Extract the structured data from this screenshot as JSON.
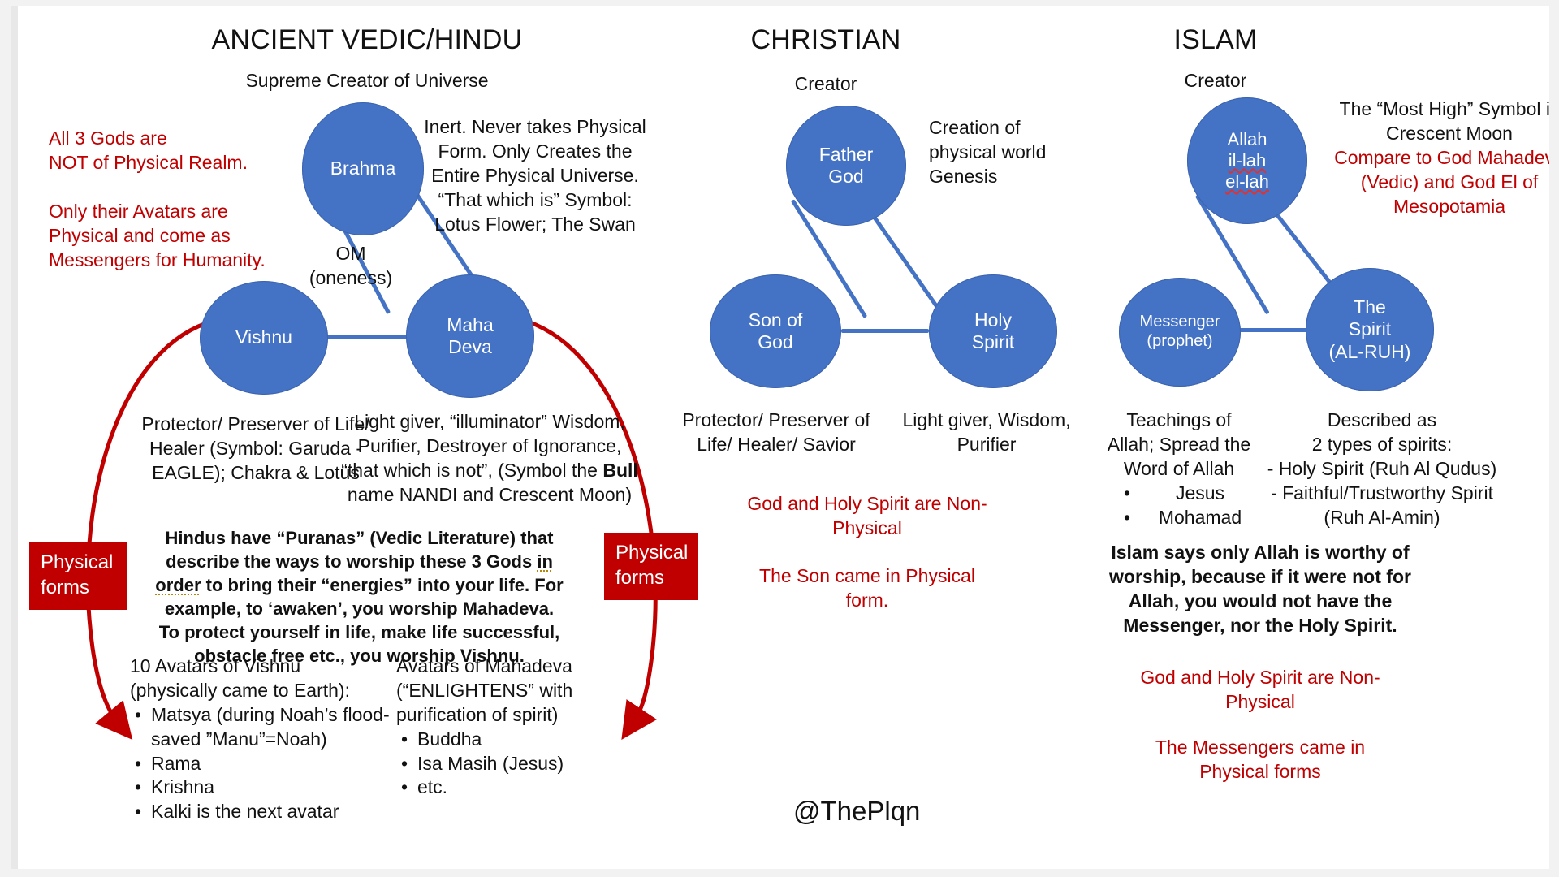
{
  "theme": {
    "node_fill": "#4472C4",
    "accent_red": "#C00000",
    "arrow_red": "#C00000",
    "text_color": "#111111",
    "slide_bg": "#FFFFFF"
  },
  "columns": [
    {
      "key": "vedic",
      "title": "ANCIENT VEDIC/HINDU",
      "top_caption": "Supreme Creator of Universe",
      "nodes": [
        {
          "id": "brahma",
          "label": "Brahma"
        },
        {
          "id": "vishnu",
          "label": "Vishnu"
        },
        {
          "id": "mahadeva",
          "line1": "Maha",
          "line2": "Deva"
        }
      ],
      "center_label_line1": "OM",
      "center_label_line2": "(oneness)",
      "left_note_1_line1": "All 3 Gods are",
      "left_note_1_line2": "NOT of Physical Realm.",
      "left_note_2": "Only their Avatars are Physical and come as Messengers for Humanity.",
      "brahma_desc": "Inert. Never takes Physical Form.  Only Creates the Entire Physical Universe. “That which is” Symbol: Lotus Flower; The Swan",
      "vishnu_desc": "Protector/ Preserver of Life/ Healer (Symbol: Garuda - EAGLE); Chakra & Lotus",
      "mahadeva_desc_a": "Light giver, “illuminator” Wisdom, Purifier, Destroyer of Ignorance, “that which is not”, (Symbol the ",
      "mahadeva_desc_bold": "Bull",
      "mahadeva_desc_b": " name NANDI and Crescent Moon)",
      "puranas_a": "Hindus have “Puranas” (Vedic Literature) that describe the ways to worship these 3 Gods ",
      "puranas_underlined": "in order",
      "puranas_b": " to bring their “energies” into your life.  For example, to ‘awaken’, you worship Mahadeva.  To protect yourself in life, make life successful, obstacle free etc., you worship Vishnu.",
      "physical_forms_box_left_line1": "Physical",
      "physical_forms_box_left_line2": "forms",
      "physical_forms_box_right_line1": "Physical",
      "physical_forms_box_right_line2": "forms",
      "avatars_vishnu": {
        "heading": "10 Avatars of Vishnu",
        "subheading": "(physically came to Earth):",
        "items": [
          "Matsya (during Noah’s flood-saved ”Manu”=Noah)",
          "Rama",
          "Krishna",
          "Kalki is the next avatar"
        ]
      },
      "avatars_mahadeva": {
        "heading": "Avatars of Mahadeva",
        "subheading": "(“ENLIGHTENS” with purification of spirit)",
        "items": [
          "Buddha",
          "Isa Masih (Jesus)",
          "etc."
        ]
      }
    },
    {
      "key": "christian",
      "title": "CHRISTIAN",
      "top_caption": "Creator",
      "nodes": [
        {
          "id": "father",
          "line1": "Father",
          "line2": "God"
        },
        {
          "id": "son",
          "line1": "Son of",
          "line2": "God"
        },
        {
          "id": "holyspirit",
          "line1": "Holy",
          "line2": "Spirit"
        }
      ],
      "father_desc": "Creation of physical world Genesis",
      "son_desc": "Protector/ Preserver of Life/ Healer/ Savior",
      "spirit_desc": "Light giver, Wisdom, Purifier",
      "red_note_1": "God and Holy Spirit are Non-Physical",
      "red_note_2": "The Son came in Physical form."
    },
    {
      "key": "islam",
      "title": "ISLAM",
      "top_caption": "Creator",
      "nodes": [
        {
          "id": "allah",
          "line1": "Allah",
          "line2": "il-lah",
          "line3": "el-lah"
        },
        {
          "id": "messenger",
          "line1": "Messenger",
          "line2": "(prophet)"
        },
        {
          "id": "spirit",
          "line1": "The",
          "line2": "Spirit",
          "line3": "(AL-RUH)"
        }
      ],
      "allah_desc_black": "The “Most High” Symbol is Crescent Moon",
      "allah_desc_red": "Compare to God Mahadeva (Vedic) and God El of Mesopotamia",
      "messenger_desc": {
        "lines": [
          "Teachings of",
          "Allah; Spread the",
          "Word of Allah"
        ],
        "items": [
          "Jesus",
          "Mohamad"
        ]
      },
      "spirit_desc": {
        "lines": [
          "Described as",
          "2 types of spirits:"
        ],
        "dashes": [
          "- Holy Spirit (Ruh Al Qudus)",
          "- Faithful/Trustworthy Spirit",
          "(Ruh Al-Amin)"
        ]
      },
      "bold_note": "Islam says only Allah is worthy of worship, because if it were not for Allah, you would not have the Messenger, nor the Holy Spirit.",
      "red_note_1": "God and Holy Spirit are Non-Physical",
      "red_note_2": "The Messengers came in Physical forms"
    }
  ],
  "watermark": "@ThePlqn"
}
